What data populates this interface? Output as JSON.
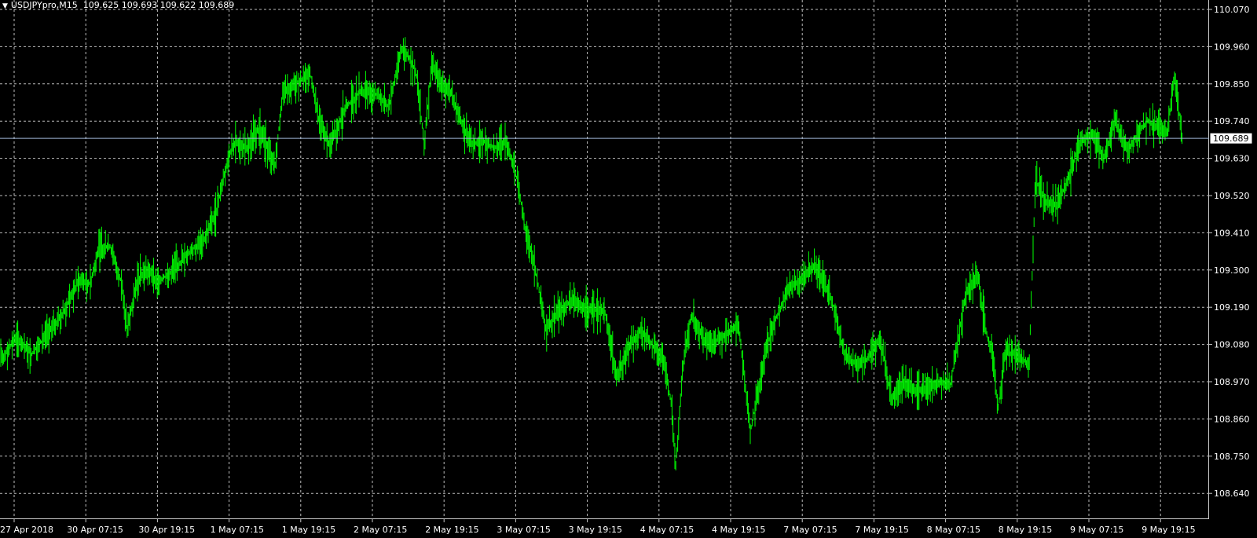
{
  "header": {
    "symbol_timeframe": "USDJPYpro,M15",
    "ohlc": "109.625 109.693 109.622 109.689"
  },
  "current_price": "109.689",
  "colors": {
    "background": "#000000",
    "bars": "#00ff00",
    "grid": "#bcbcbc",
    "text": "#ffffff",
    "price_line": "#9fb6d8"
  },
  "chart_data": {
    "type": "bar",
    "title": "USDJPYpro,M15",
    "grid": true,
    "price_ticks": [
      "110.070",
      "109.960",
      "109.850",
      "109.740",
      "109.630",
      "109.520",
      "109.410",
      "109.300",
      "109.190",
      "109.080",
      "108.970",
      "108.860",
      "108.750",
      "108.640"
    ],
    "time_ticks": [
      "27 Apr 2018",
      "30 Apr 07:15",
      "30 Apr 19:15",
      "1 May 07:15",
      "1 May 19:15",
      "2 May 07:15",
      "2 May 19:15",
      "3 May 07:15",
      "3 May 19:15",
      "4 May 07:15",
      "4 May 19:15",
      "7 May 07:15",
      "7 May 19:15",
      "8 May 07:15",
      "8 May 19:15",
      "9 May 07:15",
      "9 May 19:15"
    ],
    "ylim": [
      108.63,
      110.08
    ],
    "series": [
      {
        "values": [
          [
            0,
            109.03
          ],
          [
            20,
            109.1
          ],
          [
            40,
            109.05
          ],
          [
            60,
            109.11
          ],
          [
            80,
            109.17
          ],
          [
            100,
            109.27
          ],
          [
            115,
            109.26
          ],
          [
            125,
            109.36
          ],
          [
            140,
            109.37
          ],
          [
            155,
            109.26
          ],
          [
            162,
            109.12
          ],
          [
            175,
            109.27
          ],
          [
            190,
            109.3
          ],
          [
            200,
            109.26
          ],
          [
            220,
            109.3
          ],
          [
            240,
            109.35
          ],
          [
            260,
            109.39
          ],
          [
            275,
            109.47
          ],
          [
            290,
            109.63
          ],
          [
            300,
            109.68
          ],
          [
            315,
            109.66
          ],
          [
            330,
            109.72
          ],
          [
            340,
            109.66
          ],
          [
            350,
            109.61
          ],
          [
            360,
            109.82
          ],
          [
            375,
            109.85
          ],
          [
            395,
            109.88
          ],
          [
            405,
            109.75
          ],
          [
            420,
            109.67
          ],
          [
            440,
            109.78
          ],
          [
            460,
            109.83
          ],
          [
            480,
            109.82
          ],
          [
            495,
            109.78
          ],
          [
            510,
            109.95
          ],
          [
            520,
            109.93
          ],
          [
            530,
            109.88
          ],
          [
            540,
            109.67
          ],
          [
            550,
            109.92
          ],
          [
            560,
            109.85
          ],
          [
            575,
            109.82
          ],
          [
            590,
            109.72
          ],
          [
            600,
            109.67
          ],
          [
            615,
            109.68
          ],
          [
            630,
            109.66
          ],
          [
            645,
            109.68
          ],
          [
            660,
            109.55
          ],
          [
            670,
            109.4
          ],
          [
            680,
            109.32
          ],
          [
            695,
            109.12
          ],
          [
            710,
            109.18
          ],
          [
            730,
            109.21
          ],
          [
            750,
            109.18
          ],
          [
            770,
            109.18
          ],
          [
            785,
            108.98
          ],
          [
            800,
            109.07
          ],
          [
            815,
            109.12
          ],
          [
            830,
            109.08
          ],
          [
            845,
            109.03
          ],
          [
            855,
            108.9
          ],
          [
            860,
            108.72
          ],
          [
            870,
            109.03
          ],
          [
            880,
            109.17
          ],
          [
            890,
            109.12
          ],
          [
            900,
            109.08
          ],
          [
            920,
            109.1
          ],
          [
            940,
            109.14
          ],
          [
            955,
            108.82
          ],
          [
            965,
            108.94
          ],
          [
            975,
            109.07
          ],
          [
            990,
            109.17
          ],
          [
            1005,
            109.25
          ],
          [
            1020,
            109.27
          ],
          [
            1035,
            109.31
          ],
          [
            1050,
            109.26
          ],
          [
            1060,
            109.2
          ],
          [
            1075,
            109.05
          ],
          [
            1090,
            109.02
          ],
          [
            1105,
            109.04
          ],
          [
            1120,
            109.1
          ],
          [
            1135,
            108.92
          ],
          [
            1150,
            108.97
          ],
          [
            1165,
            108.94
          ],
          [
            1180,
            108.95
          ],
          [
            1195,
            108.97
          ],
          [
            1210,
            108.96
          ],
          [
            1230,
            109.24
          ],
          [
            1245,
            109.28
          ],
          [
            1255,
            109.12
          ],
          [
            1265,
            109.03
          ],
          [
            1270,
            108.88
          ],
          [
            1280,
            109.06
          ],
          [
            1295,
            109.05
          ],
          [
            1310,
            109.02
          ],
          [
            1318,
            109.57
          ],
          [
            1330,
            109.5
          ],
          [
            1345,
            109.49
          ],
          [
            1360,
            109.57
          ],
          [
            1375,
            109.68
          ],
          [
            1390,
            109.7
          ],
          [
            1405,
            109.63
          ],
          [
            1420,
            109.74
          ],
          [
            1435,
            109.65
          ],
          [
            1445,
            109.69
          ],
          [
            1460,
            109.74
          ],
          [
            1475,
            109.72
          ],
          [
            1485,
            109.7
          ],
          [
            1495,
            109.87
          ],
          [
            1505,
            109.69
          ]
        ]
      }
    ]
  }
}
